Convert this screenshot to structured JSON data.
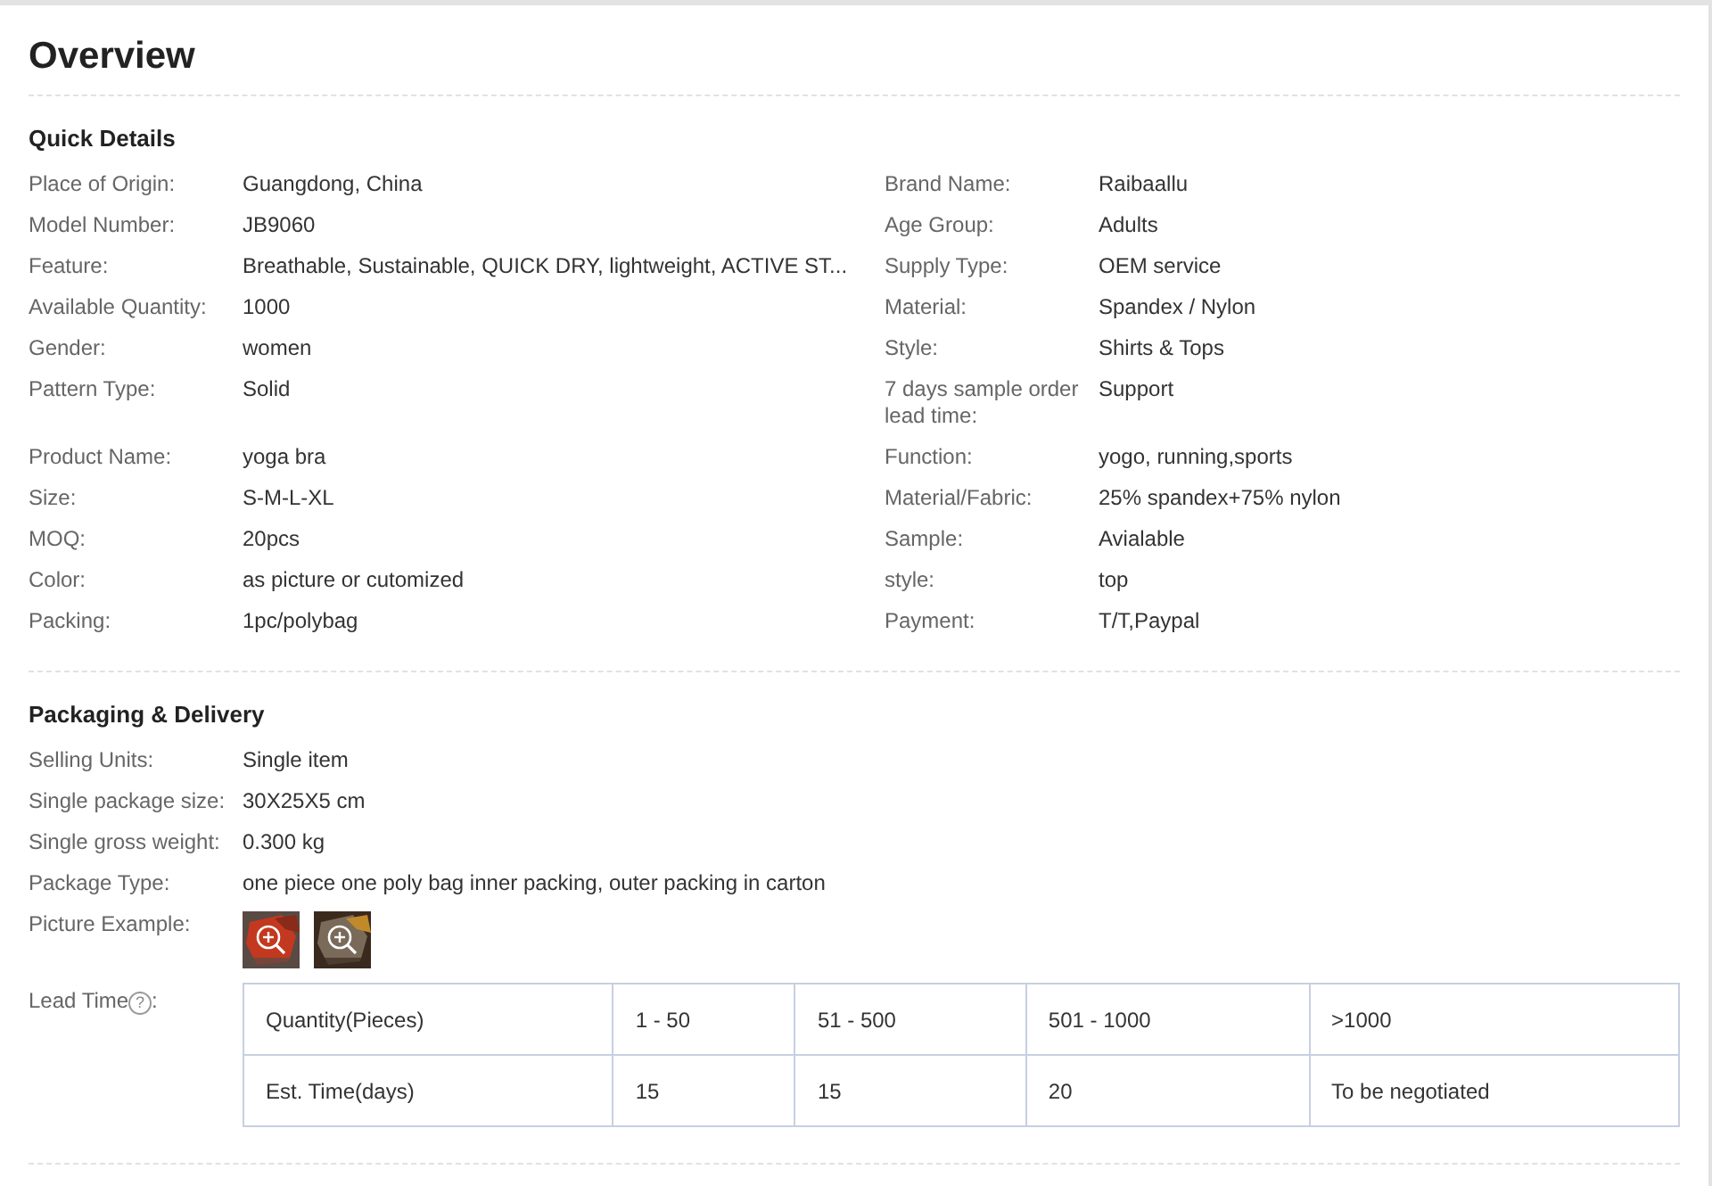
{
  "title": "Overview",
  "quick_details": {
    "heading": "Quick Details",
    "rows": [
      {
        "left": {
          "label": "Place of Origin:",
          "value": "Guangdong, China"
        },
        "right": {
          "label": "Brand Name:",
          "value": "Raibaallu"
        }
      },
      {
        "left": {
          "label": "Model Number:",
          "value": "JB9060"
        },
        "right": {
          "label": "Age Group:",
          "value": "Adults"
        }
      },
      {
        "left": {
          "label": "Feature:",
          "value": "Breathable, Sustainable, QUICK DRY, lightweight, ACTIVE ST..."
        },
        "right": {
          "label": "Supply Type:",
          "value": "OEM service"
        }
      },
      {
        "left": {
          "label": "Available Quantity:",
          "value": "1000"
        },
        "right": {
          "label": "Material:",
          "value": "Spandex / Nylon"
        }
      },
      {
        "left": {
          "label": "Gender:",
          "value": "women"
        },
        "right": {
          "label": "Style:",
          "value": "Shirts & Tops"
        }
      },
      {
        "left": {
          "label": "Pattern Type:",
          "value": "Solid"
        },
        "right": {
          "label": "7 days sample order lead time:",
          "value": "Support"
        }
      },
      {
        "left": {
          "label": "Product Name:",
          "value": "yoga bra"
        },
        "right": {
          "label": "Function:",
          "value": "yogo, running,sports"
        }
      },
      {
        "left": {
          "label": "Size:",
          "value": "S-M-L-XL"
        },
        "right": {
          "label": "Material/Fabric:",
          "value": "25% spandex+75% nylon"
        }
      },
      {
        "left": {
          "label": "MOQ:",
          "value": "20pcs"
        },
        "right": {
          "label": "Sample:",
          "value": "Avialable"
        }
      },
      {
        "left": {
          "label": "Color:",
          "value": "as picture or cutomized"
        },
        "right": {
          "label": "style:",
          "value": "top"
        }
      },
      {
        "left": {
          "label": "Packing:",
          "value": "1pc/polybag"
        },
        "right": {
          "label": "Payment:",
          "value": "T/T,Paypal"
        }
      }
    ]
  },
  "packaging": {
    "heading": "Packaging & Delivery",
    "fields": [
      {
        "label": "Selling Units:",
        "value": "Single item"
      },
      {
        "label": "Single package size:",
        "value": "30X25X5 cm"
      },
      {
        "label": "Single gross weight:",
        "value": "0.300 kg"
      },
      {
        "label": "Package Type:",
        "value": "one piece one poly bag inner packing, outer packing in carton"
      }
    ],
    "picture_example": {
      "label": "Picture Example:"
    },
    "lead_time": {
      "label": "Lead Time",
      "help_mark": "?",
      "label_suffix": ":",
      "table": {
        "rows": [
          [
            "Quantity(Pieces)",
            "1 - 50",
            "51 - 500",
            "501 - 1000",
            ">1000"
          ],
          [
            "Est. Time(days)",
            "15",
            "15",
            "20",
            "To be negotiated"
          ]
        ]
      }
    }
  }
}
